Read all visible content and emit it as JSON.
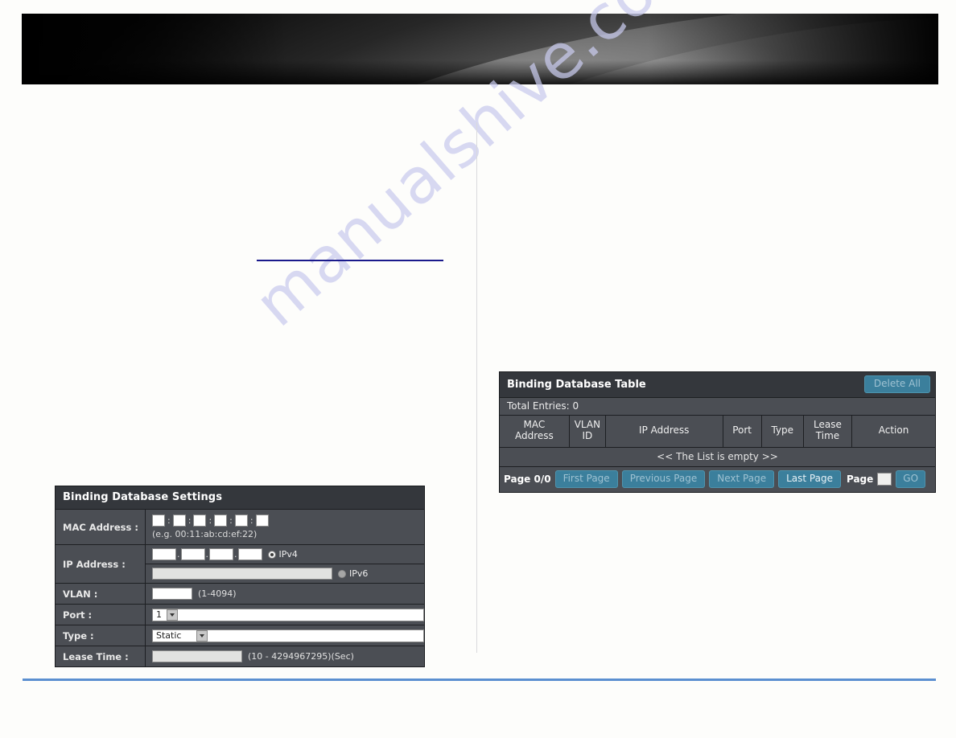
{
  "banner": {
    "name": "product-header-banner"
  },
  "watermark": {
    "text": "manualshive.com"
  },
  "settings_panel": {
    "title": "Binding Database Settings",
    "mac_row": {
      "label": "MAC Address :",
      "octet_count": 6,
      "separator": ":",
      "hint": "(e.g. 00:11:ab:cd:ef:22)",
      "values": [
        "",
        "",
        "",
        "",
        "",
        ""
      ]
    },
    "ip_row": {
      "label": "IP Address :",
      "ipv4_values": [
        "",
        "",
        "",
        ""
      ],
      "ipv4_separator": ".",
      "ipv4_label": "IPv4",
      "ipv4_selected": true,
      "ipv6_value": "",
      "ipv6_label": "IPv6",
      "ipv6_selected": false
    },
    "vlan_row": {
      "label": "VLAN :",
      "value": "",
      "hint": "(1-4094)"
    },
    "port_row": {
      "label": "Port :",
      "selected": "1"
    },
    "type_row": {
      "label": "Type :",
      "selected": "Static"
    },
    "lease_row": {
      "label": "Lease Time :",
      "value": "",
      "hint": "(10 - 4294967295)(Sec)"
    }
  },
  "table_panel": {
    "title": "Binding Database Table",
    "delete_all_label": "Delete All",
    "total_entries_label": "Total Entries: 0",
    "columns": [
      "MAC\nAddress",
      "VLAN\nID",
      "IP Address",
      "Port",
      "Type",
      "Lease\nTime",
      "Action"
    ],
    "col_mac": "MAC Address",
    "col_vlan": "VLAN ID",
    "col_ip": "IP Address",
    "col_port": "Port",
    "col_type": "Type",
    "col_lease": "Lease Time",
    "col_action": "Action",
    "empty_message": "<< The List is empty >>",
    "rows": [],
    "pager": {
      "page_status": "Page 0/0",
      "first_page": "First Page",
      "previous_page": "Previous Page",
      "next_page": "Next Page",
      "last_page": "Last Page",
      "page_word": "Page",
      "page_value": "",
      "go_label": "GO"
    }
  },
  "colors": {
    "panel_bg": "#4b4e54",
    "panel_header": "#34373c",
    "button_blue": "#3b7f9c",
    "footer_rule": "#5b8fd0",
    "heading_rule": "#1a1a8c",
    "watermark": "#c9cbee"
  }
}
